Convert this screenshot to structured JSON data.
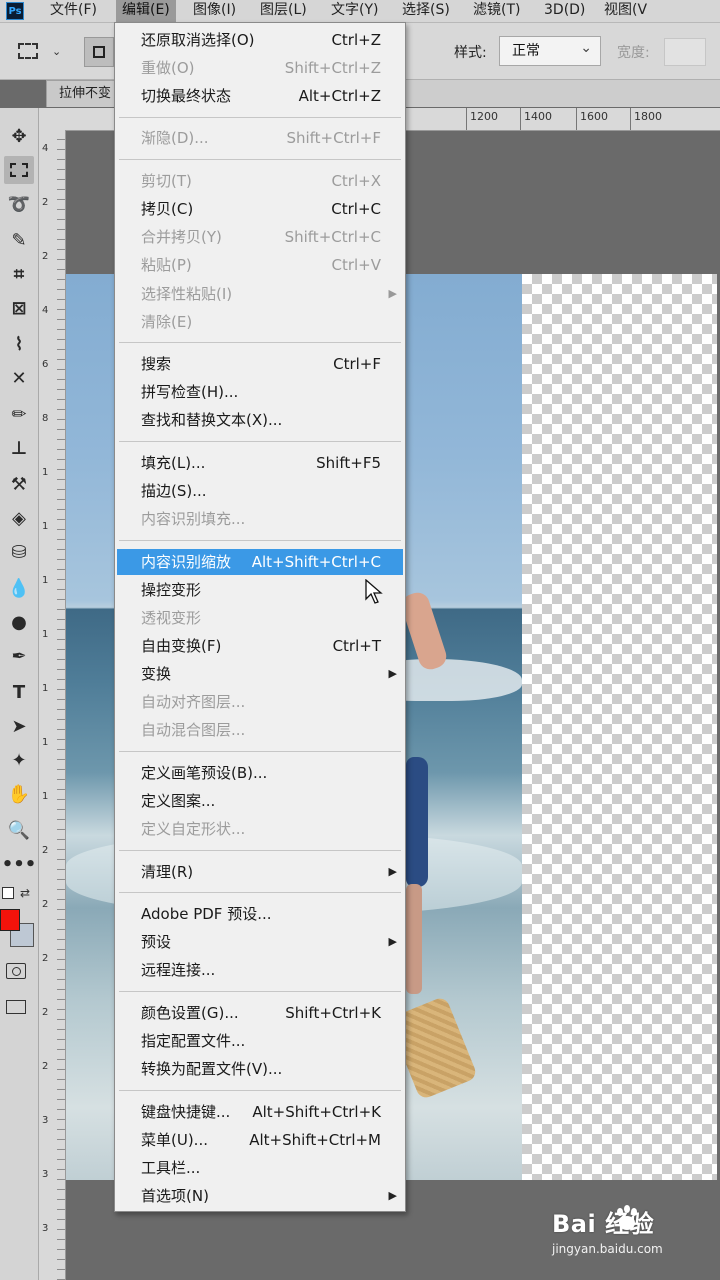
{
  "app": {
    "logo": "Ps"
  },
  "menubar": {
    "items": [
      "文件(F)",
      "编辑(E)",
      "图像(I)",
      "图层(L)",
      "文字(Y)",
      "选择(S)",
      "滤镜(T)",
      "3D(D)",
      "视图(V"
    ],
    "active_index": 1
  },
  "options": {
    "style_label": "样式:",
    "style_value": "正常",
    "width_label": "宽度:"
  },
  "document": {
    "tab_title": "拉伸不变"
  },
  "ruler": {
    "h_labels": [
      "1200",
      "1400",
      "1600",
      "1800"
    ],
    "v_labels": [
      "4",
      "2",
      "2",
      "4",
      "6",
      "8",
      "1",
      "1",
      "1",
      "1",
      "1",
      "1",
      "1",
      "2",
      "2",
      "2",
      "2",
      "2",
      "3",
      "3",
      "3"
    ]
  },
  "toolbar": {
    "tools": [
      "move-icon",
      "rect-marquee-icon",
      "lasso-icon",
      "quick-select-icon",
      "crop-icon",
      "frame-icon",
      "eyedropper-icon",
      "healing-icon",
      "brush-icon",
      "stamp-icon",
      "history-brush-icon",
      "eraser-icon",
      "paint-bucket-icon",
      "blur-icon",
      "dodge-icon",
      "pen-icon",
      "type-icon",
      "path-select-icon",
      "shape-icon",
      "hand-icon",
      "zoom-icon",
      "more-icon"
    ],
    "foreground_color": "#f4130b",
    "background_color": "#bec8d4"
  },
  "edit_menu": {
    "items": [
      {
        "label": "还原取消选择(O)",
        "shortcut": "Ctrl+Z",
        "disabled": false
      },
      {
        "label": "重做(O)",
        "shortcut": "Shift+Ctrl+Z",
        "disabled": true
      },
      {
        "label": "切换最终状态",
        "shortcut": "Alt+Ctrl+Z",
        "disabled": false
      },
      {
        "label": "渐隐(D)...",
        "shortcut": "Shift+Ctrl+F",
        "disabled": true
      },
      {
        "label": "剪切(T)",
        "shortcut": "Ctrl+X",
        "disabled": true
      },
      {
        "label": "拷贝(C)",
        "shortcut": "Ctrl+C",
        "disabled": false
      },
      {
        "label": "合并拷贝(Y)",
        "shortcut": "Shift+Ctrl+C",
        "disabled": true
      },
      {
        "label": "粘贴(P)",
        "shortcut": "Ctrl+V",
        "disabled": true
      },
      {
        "label": "选择性粘贴(I)",
        "shortcut": "",
        "disabled": true,
        "submenu": true
      },
      {
        "label": "清除(E)",
        "shortcut": "",
        "disabled": true
      },
      {
        "label": "搜索",
        "shortcut": "Ctrl+F",
        "disabled": false
      },
      {
        "label": "拼写检查(H)...",
        "shortcut": "",
        "disabled": false
      },
      {
        "label": "查找和替换文本(X)...",
        "shortcut": "",
        "disabled": false
      },
      {
        "label": "填充(L)...",
        "shortcut": "Shift+F5",
        "disabled": false
      },
      {
        "label": "描边(S)...",
        "shortcut": "",
        "disabled": false
      },
      {
        "label": "内容识别填充...",
        "shortcut": "",
        "disabled": true
      },
      {
        "label": "内容识别缩放",
        "shortcut": "Alt+Shift+Ctrl+C",
        "disabled": false,
        "highlighted": true
      },
      {
        "label": "操控变形",
        "shortcut": "",
        "disabled": false
      },
      {
        "label": "透视变形",
        "shortcut": "",
        "disabled": true
      },
      {
        "label": "自由变换(F)",
        "shortcut": "Ctrl+T",
        "disabled": false
      },
      {
        "label": "变换",
        "shortcut": "",
        "disabled": false,
        "submenu": true
      },
      {
        "label": "自动对齐图层...",
        "shortcut": "",
        "disabled": true
      },
      {
        "label": "自动混合图层...",
        "shortcut": "",
        "disabled": true
      },
      {
        "label": "定义画笔预设(B)...",
        "shortcut": "",
        "disabled": false
      },
      {
        "label": "定义图案...",
        "shortcut": "",
        "disabled": false
      },
      {
        "label": "定义自定形状...",
        "shortcut": "",
        "disabled": true
      },
      {
        "label": "清理(R)",
        "shortcut": "",
        "disabled": false,
        "submenu": true
      },
      {
        "label": "Adobe PDF 预设...",
        "shortcut": "",
        "disabled": false
      },
      {
        "label": "预设",
        "shortcut": "",
        "disabled": false,
        "submenu": true
      },
      {
        "label": "远程连接...",
        "shortcut": "",
        "disabled": false
      },
      {
        "label": "颜色设置(G)...",
        "shortcut": "Shift+Ctrl+K",
        "disabled": false
      },
      {
        "label": "指定配置文件...",
        "shortcut": "",
        "disabled": false
      },
      {
        "label": "转换为配置文件(V)...",
        "shortcut": "",
        "disabled": false
      },
      {
        "label": "键盘快捷键...",
        "shortcut": "Alt+Shift+Ctrl+K",
        "disabled": false
      },
      {
        "label": "菜单(U)...",
        "shortcut": "Alt+Shift+Ctrl+M",
        "disabled": false
      },
      {
        "label": "工具栏...",
        "shortcut": "",
        "disabled": false
      },
      {
        "label": "首选项(N)",
        "shortcut": "",
        "disabled": false,
        "submenu": true
      }
    ]
  },
  "watermark": {
    "brand": "Bai  经验",
    "url": "jingyan.baidu.com"
  },
  "colors": {
    "menu_highlight": "#3b99e6",
    "canvas_bg": "#6a6a6a"
  }
}
